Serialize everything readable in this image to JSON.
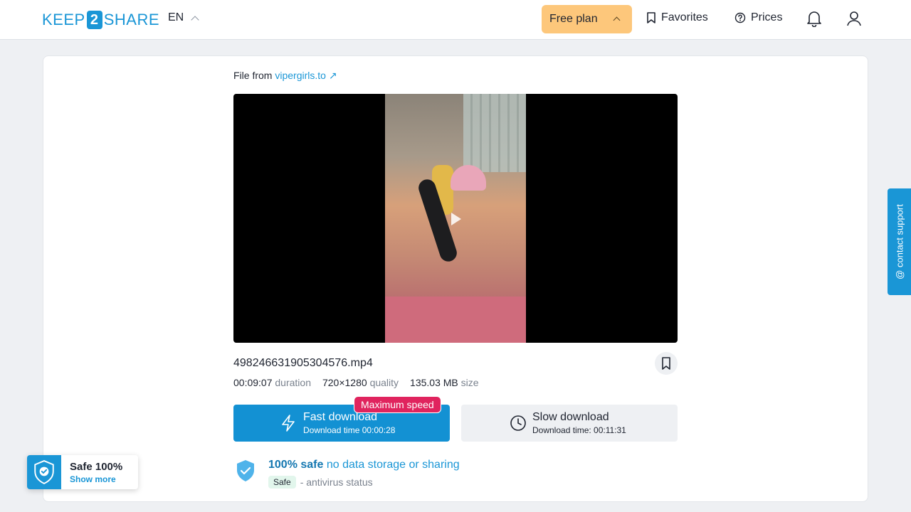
{
  "header": {
    "logo": {
      "left": "KEEP",
      "middle": "2",
      "right": "SHARE"
    },
    "language": "EN",
    "plan_label": "Free plan",
    "favorites_label": "Favorites",
    "prices_label": "Prices"
  },
  "file": {
    "from_label": "File from",
    "source_link": "vipergirls.to",
    "name": "498246631905304576.mp4",
    "duration_value": "00:09:07",
    "duration_unit": "duration",
    "quality_value": "720×1280",
    "quality_unit": "quality",
    "size_value": "135.03 MB",
    "size_unit": "size"
  },
  "download": {
    "badge": "Maximum speed",
    "fast_label": "Fast download",
    "fast_time": "Download time 00:00:28",
    "slow_label": "Slow download",
    "slow_time": "Download time: 00:11:31"
  },
  "safety": {
    "strong": "100% safe",
    "rest": "no data storage or sharing",
    "pill": "Safe",
    "status": "- antivirus status"
  },
  "widget": {
    "title": "Safe 100%",
    "link": "Show more"
  },
  "support_label": "@ contact support",
  "colors": {
    "brand": "#1a96d6",
    "plan": "#fdc77b",
    "badge": "#e0245e",
    "safe_pill": "#e2f6ec"
  }
}
